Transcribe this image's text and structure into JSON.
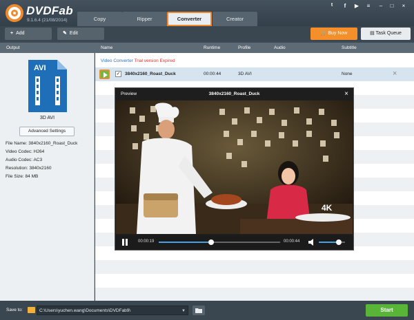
{
  "app": {
    "brand": "DVDFab",
    "version": "9.1.6.4 (21/08/2014)"
  },
  "tabs": [
    {
      "label": "Copy"
    },
    {
      "label": "Ripper"
    },
    {
      "label": "Converter",
      "active": true
    },
    {
      "label": "Creator"
    }
  ],
  "toolbar": {
    "add_label": "Add",
    "edit_label": "Edit",
    "buy_label": "Buy Now",
    "task_label": "Task Queue"
  },
  "columns": {
    "output": "Output",
    "name": "Name",
    "runtime": "Runtime",
    "profile": "Profile",
    "audio": "Audio",
    "subtitle": "Subtitle"
  },
  "left_panel": {
    "badge": "AVI",
    "format_name": "3D AVI",
    "advanced_label": "Advanced Settings",
    "info": [
      "File Name: 3840x2160_Roast_Duck",
      "Video Codec: H264",
      "Audio Codec: AC3",
      "Resolution: 3840x2160",
      "File Size: 84 MB"
    ]
  },
  "list": {
    "mode": "Video Converter",
    "trial": "Trial version",
    "expired": "Expired",
    "row": {
      "checked": "✓",
      "name": "3840x2160_Roast_Duck",
      "runtime": "00:00:44",
      "profile": "3D AVI",
      "subtitle": "None"
    }
  },
  "preview": {
    "title": "Preview",
    "filename": "3840x2160_Roast_Duck",
    "close": "×",
    "current_time": "00:00:19",
    "total_time": "00:00:44",
    "progress": 0.43,
    "volume": 0.75,
    "watermark": "4K"
  },
  "bottom": {
    "save_label": "Save to:",
    "path": "C:\\Users\\yuchen.wang\\Documents\\DVDFab9\\"
  },
  "start_label": "Start",
  "colors": {
    "accent": "#f08a2c",
    "start": "#58b537",
    "link": "#2b70c2",
    "warning": "#d9342b"
  }
}
